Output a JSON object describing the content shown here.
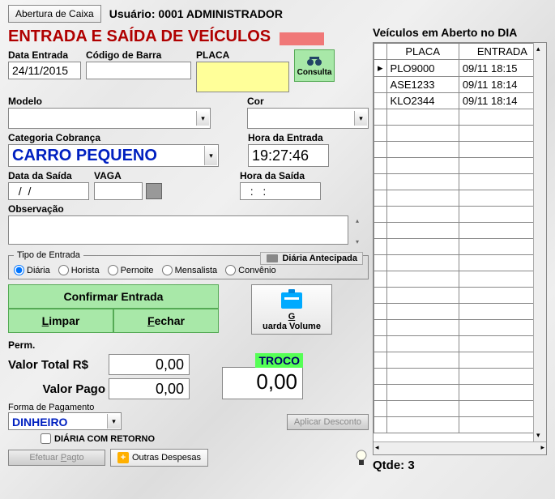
{
  "top": {
    "abertura": "Abertura de Caixa",
    "usuario_label": "Usuário:",
    "usuario_value": "0001 ADMINISTRADOR"
  },
  "title": "ENTRADA E SAÍDA DE VEÍCULOS",
  "labels": {
    "data_entrada": "Data Entrada",
    "codigo_barra": "Código de Barra",
    "placa": "PLACA",
    "consulta": "Consulta",
    "modelo": "Modelo",
    "cor": "Cor",
    "categoria": "Categoria Cobrança",
    "hora_entrada": "Hora da Entrada",
    "data_saida": "Data da Saída",
    "vaga": "VAGA",
    "hora_saida": "Hora da Saída",
    "observacao": "Observação",
    "tipo_entrada": "Tipo de Entrada",
    "diaria_antecipada": "Diária Antecipada",
    "perm": "Perm.",
    "valor_total": "Valor Total R$",
    "valor_pago": "Valor Pago",
    "troco": "TROCO",
    "forma_pagamento": "Forma de Pagamento",
    "aplicar_desconto": "Aplicar Desconto",
    "diaria_retorno": "DIÁRIA COM RETORNO",
    "efetuar_pagto": "Efetuar Pagto",
    "outras_despesas": "Outras Despesas"
  },
  "fields": {
    "data_entrada": "24/11/2015",
    "codigo_barra": "",
    "placa": "",
    "modelo": "",
    "cor": "",
    "categoria": "CARRO PEQUENO",
    "hora_entrada": "19:27:46",
    "data_saida": "  /  /",
    "vaga": "",
    "hora_saida": "  :   :",
    "observacao": "",
    "valor_total": "0,00",
    "valor_pago": "0,00",
    "troco": "0,00",
    "forma_pagamento": "DINHEIRO"
  },
  "radios": {
    "diaria": "Diária",
    "horista": "Horista",
    "pernoite": "Pernoite",
    "mensalista": "Mensalista",
    "convenio": "Convênio"
  },
  "buttons": {
    "confirmar": "Confirmar Entrada",
    "limpar": "Limpar",
    "fechar": "Fechar",
    "guarda_volume": "Guarda Volume"
  },
  "right": {
    "title": "Veículos em Aberto no DIA",
    "cols": {
      "placa": "PLACA",
      "entrada": "ENTRADA"
    },
    "rows": [
      {
        "placa": "PLO9000",
        "entrada": "09/11 18:15"
      },
      {
        "placa": "ASE1233",
        "entrada": "09/11 18:14"
      },
      {
        "placa": "KLO2344",
        "entrada": "09/11 18:14"
      }
    ],
    "qtde_label": "Qtde:",
    "qtde_value": "3"
  }
}
